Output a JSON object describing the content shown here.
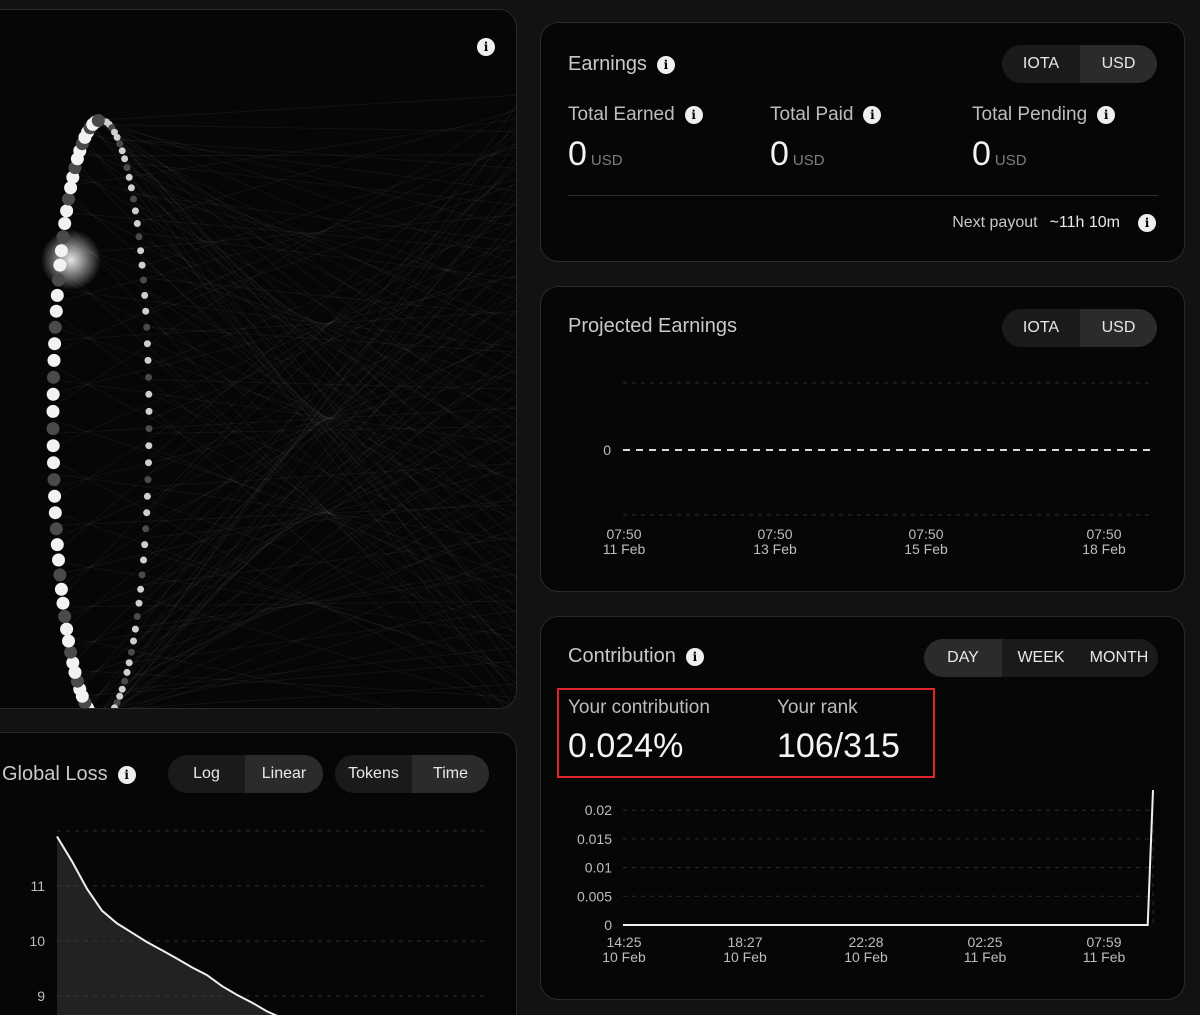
{
  "earnings": {
    "title": "Earnings",
    "currency_toggle": [
      "IOTA",
      "USD"
    ],
    "active_currency": "USD",
    "stats": [
      {
        "label": "Total Earned",
        "value": "0",
        "unit": "USD"
      },
      {
        "label": "Total Paid",
        "value": "0",
        "unit": "USD"
      },
      {
        "label": "Total Pending",
        "value": "0",
        "unit": "USD"
      }
    ],
    "next_payout_label": "Next payout",
    "next_payout_value": "~11h 10m"
  },
  "projected": {
    "title": "Projected Earnings",
    "currency_toggle": [
      "IOTA",
      "USD"
    ],
    "active_currency": "USD"
  },
  "contribution": {
    "title": "Contribution",
    "period_toggle": [
      "DAY",
      "WEEK",
      "MONTH"
    ],
    "active_period": "DAY",
    "your_contribution_label": "Your contribution",
    "your_contribution_value": "0.024%",
    "your_rank_label": "Your rank",
    "your_rank_value": "106/315"
  },
  "global_loss": {
    "title": "Global Loss",
    "scale_toggle": [
      "Log",
      "Linear"
    ],
    "active_scale": "Linear",
    "axis_toggle": [
      "Tokens",
      "Time"
    ],
    "active_axis": "Time"
  },
  "colors": {
    "highlight_box": "#e0242b",
    "accent": "#ffffff"
  },
  "icons": {
    "info": "info-icon"
  },
  "chart_data": [
    {
      "id": "projected-earnings",
      "type": "line",
      "x": [
        "07:50 11 Feb",
        "07:50 13 Feb",
        "07:50 15 Feb",
        "07:50 18 Feb"
      ],
      "x_ticks": [
        {
          "time": "07:50",
          "date": "11 Feb"
        },
        {
          "time": "07:50",
          "date": "13 Feb"
        },
        {
          "time": "07:50",
          "date": "15 Feb"
        },
        {
          "time": "07:50",
          "date": "18 Feb"
        }
      ],
      "y_ticks": [
        "0"
      ],
      "series": [
        {
          "values": [
            0,
            0,
            0,
            0
          ],
          "style": "dashed"
        }
      ],
      "grid": true
    },
    {
      "id": "contribution",
      "type": "line",
      "x_ticks": [
        {
          "time": "14:25",
          "date": "10 Feb"
        },
        {
          "time": "18:27",
          "date": "10 Feb"
        },
        {
          "time": "22:28",
          "date": "10 Feb"
        },
        {
          "time": "02:25",
          "date": "11 Feb"
        },
        {
          "time": "07:59",
          "date": "11 Feb"
        }
      ],
      "y_ticks": [
        "0",
        "0.005",
        "0.01",
        "0.015",
        "0.02"
      ],
      "ylim": [
        0,
        0.023
      ],
      "series": [
        {
          "x_frac": [
            0,
            0.1,
            0.2,
            0.3,
            0.4,
            0.5,
            0.6,
            0.7,
            0.8,
            0.9,
            0.99,
            1.0
          ],
          "values": [
            0,
            0,
            0,
            0,
            0,
            0,
            0,
            0,
            0,
            0,
            0,
            0.0235
          ]
        }
      ],
      "grid": true
    },
    {
      "id": "global-loss",
      "type": "line",
      "y_ticks": [
        "11",
        "10",
        "9"
      ],
      "ylim": [
        8.6,
        12.0
      ],
      "series": [
        {
          "x_frac": [
            0,
            0.05,
            0.1,
            0.15,
            0.2,
            0.25,
            0.3,
            0.35,
            0.4,
            0.45,
            0.5,
            0.55,
            0.6,
            0.65,
            0.7,
            0.75
          ],
          "values": [
            11.9,
            11.45,
            10.95,
            10.55,
            10.32,
            10.15,
            9.98,
            9.83,
            9.68,
            9.52,
            9.38,
            9.18,
            9.02,
            8.88,
            8.72,
            8.6
          ]
        }
      ],
      "grid": true
    }
  ]
}
